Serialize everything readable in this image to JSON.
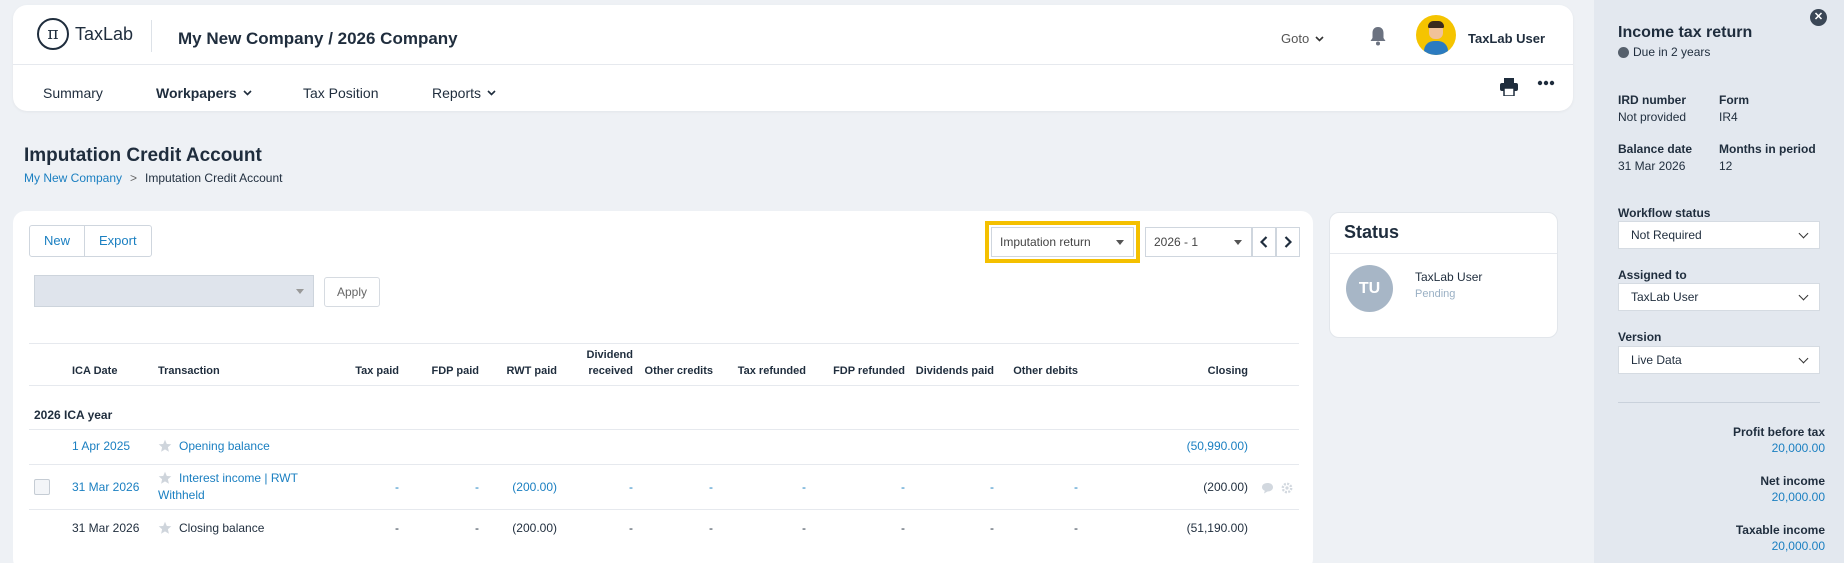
{
  "header": {
    "logo_symbol": "π",
    "logo_text": "TaxLab",
    "company": "My New Company / 2026 Company",
    "goto_label": "Goto",
    "user_name": "TaxLab User"
  },
  "nav": {
    "summary": "Summary",
    "workpapers": "Workpapers",
    "tax_position": "Tax Position",
    "reports": "Reports"
  },
  "page": {
    "title": "Imputation Credit Account",
    "breadcrumb_root": "My New Company",
    "breadcrumb_sep": ">",
    "breadcrumb_current": "Imputation Credit Account"
  },
  "toolbar": {
    "new_label": "New",
    "export_label": "Export",
    "return_select": "Imputation return",
    "period_select": "2026 - 1",
    "apply_label": "Apply"
  },
  "table": {
    "headers": {
      "ica_date": "ICA Date",
      "transaction": "Transaction",
      "tax_paid": "Tax paid",
      "fdp_paid": "FDP paid",
      "rwt_paid": "RWT paid",
      "dividend_received_1": "Dividend",
      "dividend_received_2": "received",
      "other_credits": "Other credits",
      "tax_refunded": "Tax refunded",
      "fdp_refunded": "FDP refunded",
      "dividends_paid": "Dividends paid",
      "other_debits": "Other debits",
      "closing": "Closing"
    },
    "group_label": "2026 ICA year",
    "rows": [
      {
        "date": "1 Apr 2025",
        "transaction": "Opening balance",
        "closing": "(50,990.00)"
      },
      {
        "date": "31 Mar 2026",
        "transaction_1": "Interest income | RWT",
        "transaction_2": "Withheld",
        "tax_paid": "-",
        "fdp_paid": "-",
        "rwt_paid": "(200.00)",
        "dividend_received": "-",
        "other_credits": "-",
        "tax_refunded": "-",
        "fdp_refunded": "-",
        "dividends_paid": "-",
        "other_debits": "-",
        "closing": "(200.00)"
      },
      {
        "date": "31 Mar 2026",
        "transaction": "Closing balance",
        "tax_paid": "-",
        "fdp_paid": "-",
        "rwt_paid": "(200.00)",
        "dividend_received": "-",
        "other_credits": "-",
        "tax_refunded": "-",
        "fdp_refunded": "-",
        "dividends_paid": "-",
        "other_debits": "-",
        "closing": "(51,190.00)"
      }
    ]
  },
  "status": {
    "title": "Status",
    "initials": "TU",
    "name": "TaxLab User",
    "state": "Pending"
  },
  "panel": {
    "close_symbol": "✕",
    "title": "Income tax return",
    "due": "Due in 2 years",
    "ird_label": "IRD number",
    "ird_value": "Not provided",
    "form_label": "Form",
    "form_value": "IR4",
    "balance_label": "Balance date",
    "balance_value": "31 Mar 2026",
    "months_label": "Months in period",
    "months_value": "12",
    "workflow_label": "Workflow status",
    "workflow_value": "Not Required",
    "assigned_label": "Assigned to",
    "assigned_value": "TaxLab User",
    "version_label": "Version",
    "version_value": "Live Data",
    "profit_label": "Profit before tax",
    "profit_value": "20,000.00",
    "net_label": "Net income",
    "net_value": "20,000.00",
    "taxable_label": "Taxable income",
    "taxable_value": "20,000.00"
  },
  "colors": {
    "accent": "#1a7fc1",
    "highlight": "#f4c000",
    "panel_bg": "#e3e8ef"
  }
}
